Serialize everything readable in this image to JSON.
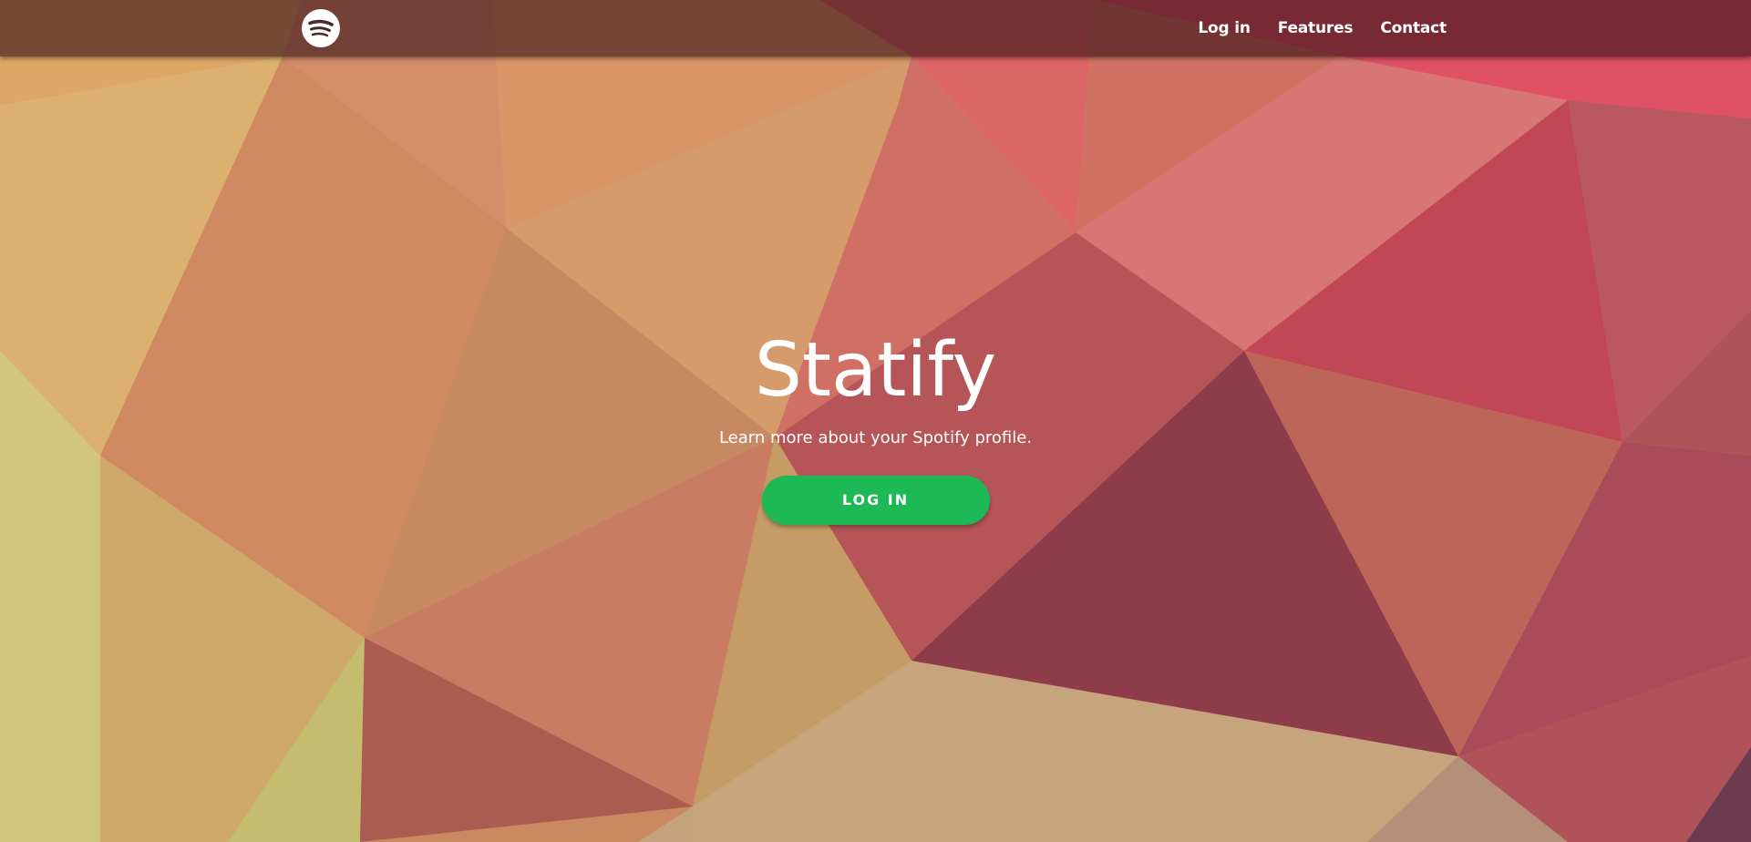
{
  "navbar": {
    "logo_icon": "spotify-icon",
    "links": [
      {
        "label": "Log in"
      },
      {
        "label": "Features"
      },
      {
        "label": "Contact"
      }
    ]
  },
  "hero": {
    "title": "Statify",
    "subtitle": "Learn more about your Spotify profile.",
    "button_label": "LOG IN"
  },
  "colors": {
    "accent_button": "#1db954",
    "navbar_overlay": "#37121699",
    "text": "#ffffff"
  }
}
